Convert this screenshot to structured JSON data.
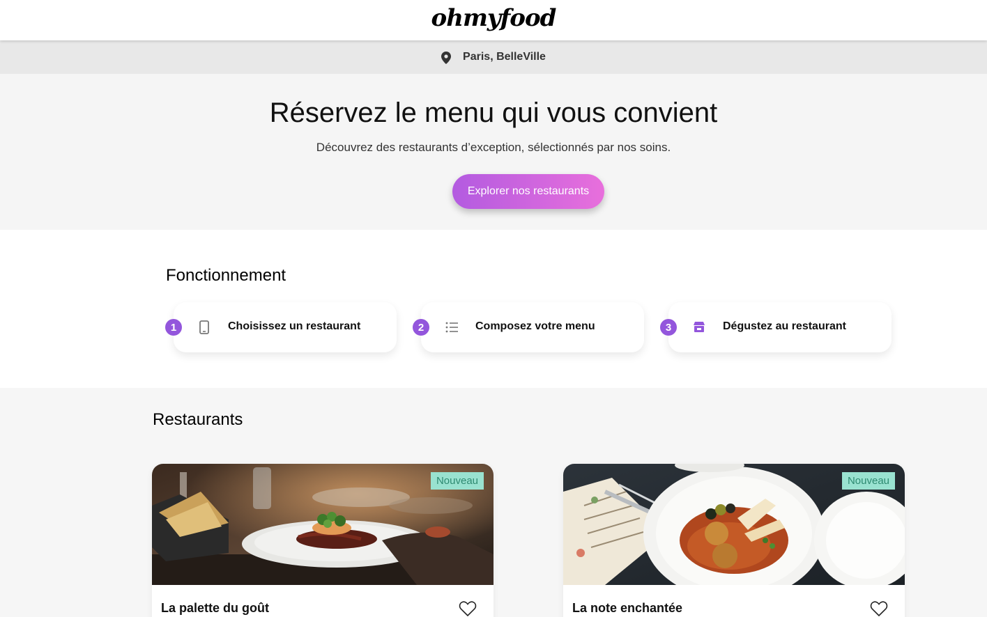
{
  "header": {
    "logo": "ohmyfood"
  },
  "location": {
    "icon": "map-pin-icon",
    "label": "Paris, BelleVille"
  },
  "hero": {
    "title": "Réservez le menu qui vous convient",
    "subtitle": "Découvrez des restaurants d’exception, sélectionnés par nos soins.",
    "cta_label": "Explorer nos restaurants"
  },
  "how": {
    "title": "Fonctionnement",
    "steps": [
      {
        "num": "1",
        "icon": "phone-icon",
        "label": "Choisissez un restaurant"
      },
      {
        "num": "2",
        "icon": "list-icon",
        "label": "Composez votre menu"
      },
      {
        "num": "3",
        "icon": "store-icon",
        "label": "Dégustez au restaurant"
      }
    ]
  },
  "restaurants": {
    "title": "Restaurants",
    "items": [
      {
        "name": "La palette du goût",
        "badge": "Nouveau",
        "favorite_icon": "heart-icon"
      },
      {
        "name": "La note enchantée",
        "badge": "Nouveau",
        "favorite_icon": "heart-icon"
      }
    ]
  },
  "colors": {
    "primary": "#9356dc",
    "secondary": "#ff79da",
    "tertiary": "#99e2d0"
  }
}
